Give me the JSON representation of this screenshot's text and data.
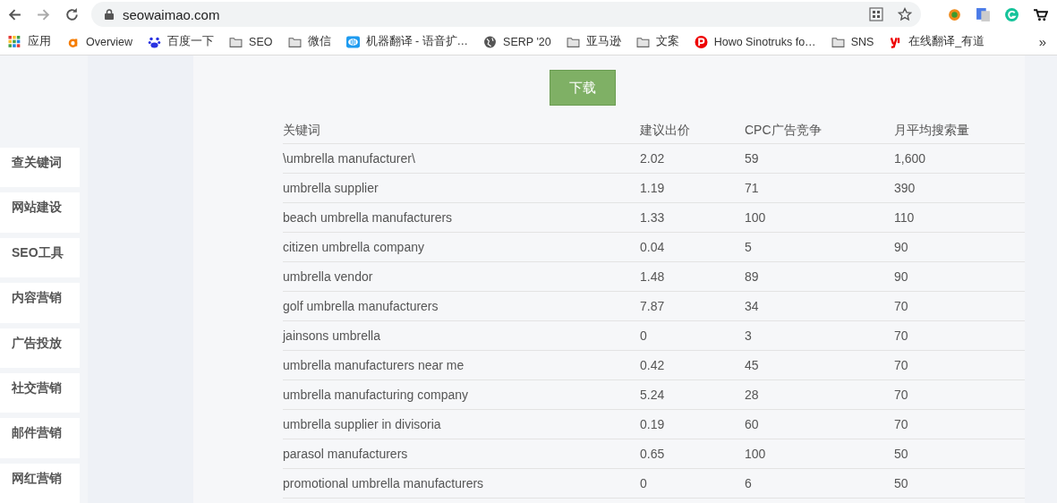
{
  "browser": {
    "url": "seowaimao.com",
    "bookmarks": [
      {
        "label": "应用",
        "kind": "apps"
      },
      {
        "label": "Overview",
        "kind": "amazon"
      },
      {
        "label": "百度一下",
        "kind": "baidu"
      },
      {
        "label": "SEO",
        "kind": "folder"
      },
      {
        "label": "微信",
        "kind": "folder"
      },
      {
        "label": "机器翻译 - 语音扩…",
        "kind": "translate"
      },
      {
        "label": "SERP '20",
        "kind": "globe"
      },
      {
        "label": "亚马逊",
        "kind": "folder"
      },
      {
        "label": "文案",
        "kind": "folder"
      },
      {
        "label": "Howo Sinotruks fo…",
        "kind": "p"
      },
      {
        "label": "SNS",
        "kind": "folder"
      },
      {
        "label": "在线翻译_有道",
        "kind": "youdao"
      }
    ],
    "more": "»"
  },
  "sidebar": {
    "items": [
      "查关键词",
      "网站建设",
      "SEO工具",
      "内容营销",
      "广告投放",
      "社交营销",
      "邮件营销",
      "网红营销"
    ]
  },
  "download_button": "下载",
  "table": {
    "columns": [
      "关键词",
      "建议出价",
      "CPC广告竞争",
      "月平均搜索量"
    ],
    "rows": [
      [
        "\\umbrella manufacturer\\",
        "2.02",
        "59",
        "1,600"
      ],
      [
        "umbrella supplier",
        "1.19",
        "71",
        "390"
      ],
      [
        "beach umbrella manufacturers",
        "1.33",
        "100",
        "110"
      ],
      [
        "citizen umbrella company",
        "0.04",
        "5",
        "90"
      ],
      [
        "umbrella vendor",
        "1.48",
        "89",
        "90"
      ],
      [
        "golf umbrella manufacturers",
        "7.87",
        "34",
        "70"
      ],
      [
        "jainsons umbrella",
        "0",
        "3",
        "70"
      ],
      [
        "umbrella manufacturers near me",
        "0.42",
        "45",
        "70"
      ],
      [
        "umbrella manufacturing company",
        "5.24",
        "28",
        "70"
      ],
      [
        "umbrella supplier in divisoria",
        "0.19",
        "60",
        "70"
      ],
      [
        "parasol manufacturers",
        "0.65",
        "100",
        "50"
      ],
      [
        "promotional umbrella manufacturers",
        "0",
        "6",
        "50"
      ]
    ]
  }
}
